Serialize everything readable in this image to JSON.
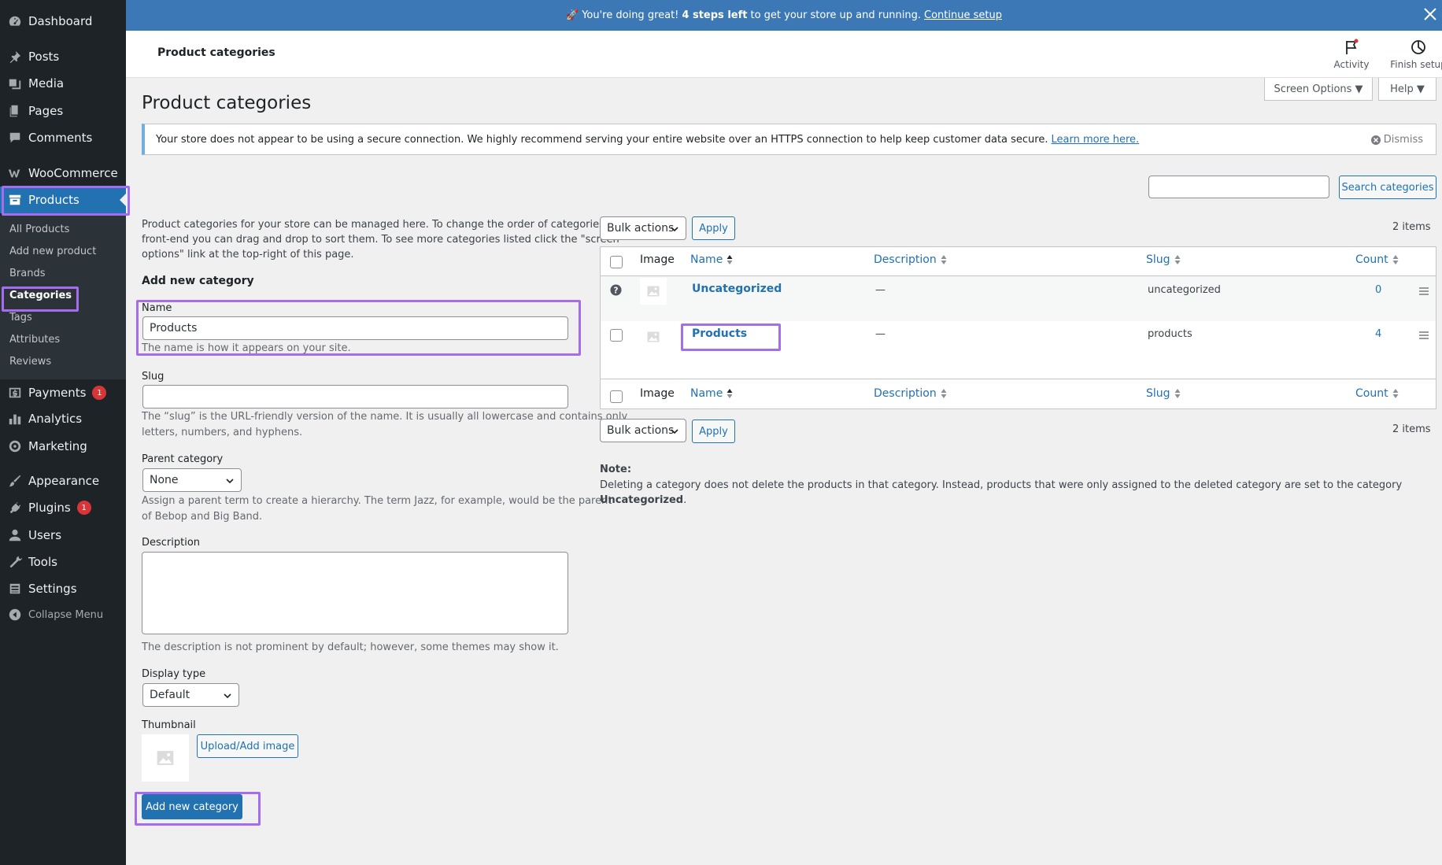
{
  "sidebar": {
    "dashboard": "Dashboard",
    "posts": "Posts",
    "media": "Media",
    "pages": "Pages",
    "comments": "Comments",
    "woocommerce": "WooCommerce",
    "products": "Products",
    "submenu": [
      "All Products",
      "Add new product",
      "Brands",
      "Categories",
      "Tags",
      "Attributes",
      "Reviews"
    ],
    "payments": "Payments",
    "payments_badge": "1",
    "analytics": "Analytics",
    "marketing": "Marketing",
    "appearance": "Appearance",
    "plugins": "Plugins",
    "plugins_badge": "1",
    "users": "Users",
    "tools": "Tools",
    "settings": "Settings",
    "collapse": "Collapse Menu"
  },
  "banner": {
    "emoji": "🚀",
    "text_before": "You're doing great!",
    "bold": "4 steps left",
    "text_after": "to get your store up and running.",
    "link": "Continue setup"
  },
  "header": {
    "title": "Product categories",
    "activity": "Activity",
    "finish_setup": "Finish setup"
  },
  "screen_options": "Screen Options ▼",
  "help": "Help ▼",
  "page_title": "Product categories",
  "notice": {
    "text": "Your store does not appear to be using a secure connection. We highly recommend serving your entire website over an HTTPS connection to help keep customer data secure.",
    "link": "Learn more here.",
    "dismiss": "Dismiss"
  },
  "search": {
    "button": "Search categories",
    "value": ""
  },
  "form": {
    "intro_line1": "Product categories for your store can be managed here. To change the order of categories on the",
    "intro_line2": "front-end you can drag and drop to sort them. To see more categories listed click the \"screen",
    "intro_line3": "options\" link at the top-right of this page.",
    "heading": "Add new category",
    "name_label": "Name",
    "name_value": "Products",
    "name_help": "The name is how it appears on your site.",
    "slug_label": "Slug",
    "slug_value": "",
    "slug_help1": "The “slug” is the URL-friendly version of the name. It is usually all lowercase and contains only",
    "slug_help2": "letters, numbers, and hyphens.",
    "parent_label": "Parent category",
    "parent_value": "None",
    "parent_help1": "Assign a parent term to create a hierarchy. The term Jazz, for example, would be the parent",
    "parent_help2": "of Bebop and Big Band.",
    "description_label": "Description",
    "description_help": "The description is not prominent by default; however, some themes may show it.",
    "display_type_label": "Display type",
    "display_type_value": "Default",
    "thumbnail_label": "Thumbnail",
    "upload_button": "Upload/Add image",
    "submit": "Add new category"
  },
  "table": {
    "bulk_actions": "Bulk actions",
    "apply": "Apply",
    "items": "2 items",
    "columns": [
      "Image",
      "Name",
      "Description",
      "Slug",
      "Count"
    ],
    "rows": [
      {
        "name": "Uncategorized",
        "description": "—",
        "slug": "uncategorized",
        "count": "0"
      },
      {
        "name": "Products",
        "description": "—",
        "slug": "products",
        "count": "4"
      }
    ]
  },
  "note": {
    "label": "Note:",
    "text": "Deleting a category does not delete the products in that category. Instead, products that were only assigned to the deleted category are set to the category",
    "bold": "Uncategorized",
    "end": "."
  },
  "colors": {
    "accent": "#2271b1",
    "sidebar_bg": "#1d2327",
    "highlight": "#a56cf0",
    "badge": "#d63638"
  }
}
